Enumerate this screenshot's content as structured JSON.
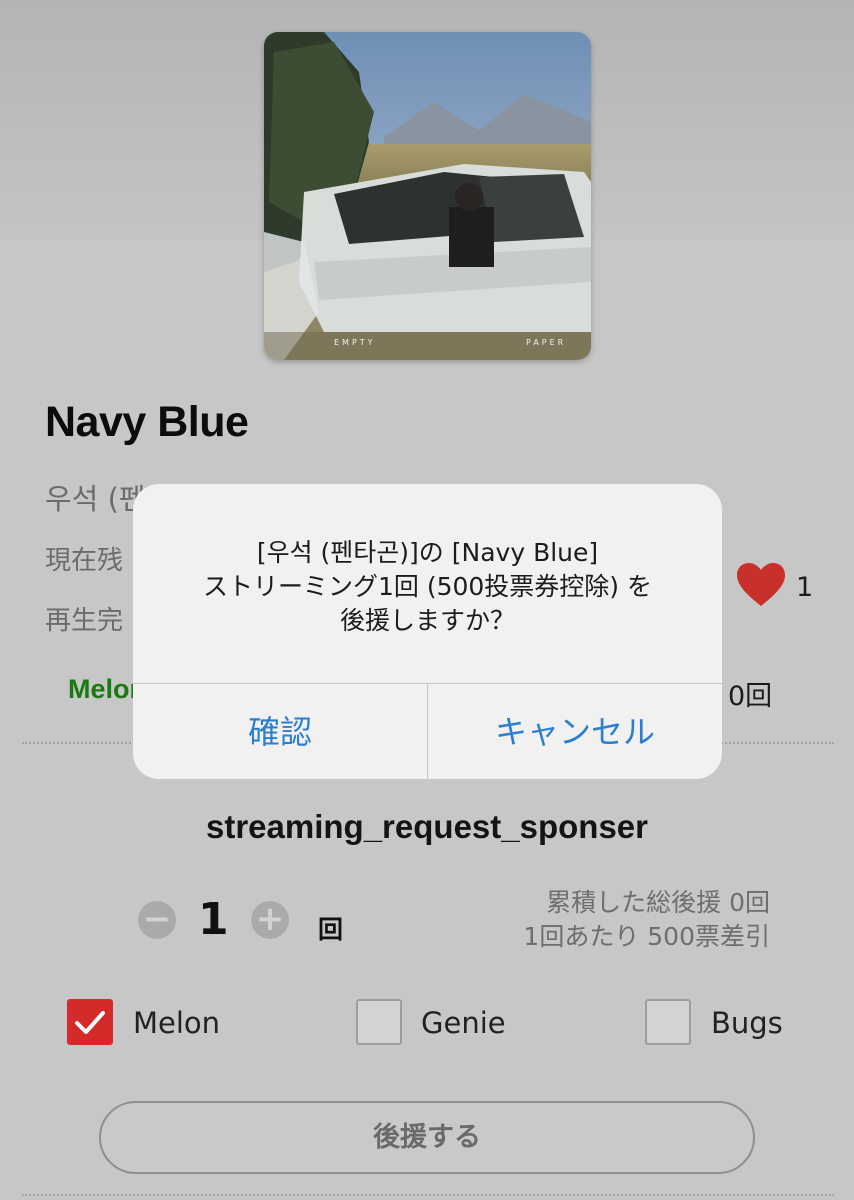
{
  "song": {
    "title": "Navy Blue",
    "artist": "우석 (펜타곤)",
    "remaining_label": "現在残",
    "playback_label": "再生完",
    "heart_count": "1",
    "platform_label": "Melon",
    "platform_count": "0回"
  },
  "cover": {
    "left_text": "EMPTY",
    "right_text": "PAPER"
  },
  "sponsor": {
    "heading": "streaming_request_sponser",
    "quantity": "1",
    "unit": "回",
    "total_support": "累積した総後援 0回",
    "per_play_cost": "1回あたり 500票差引",
    "minus": "−",
    "plus": "+"
  },
  "platforms": [
    {
      "label": "Melon",
      "checked": true
    },
    {
      "label": "Genie",
      "checked": false
    },
    {
      "label": "Bugs",
      "checked": false
    }
  ],
  "support_button_label": "後援する",
  "dialog": {
    "line1": "[우석 (펜타곤)]の [Navy Blue]",
    "line2": "ストリーミング1回 (500投票券控除) を",
    "line3": "後援しますか？",
    "confirm_label": "確認",
    "cancel_label": "キャンセル"
  },
  "colors": {
    "accent_blue": "#2b7fd1",
    "melon_green": "#1a7a12",
    "heart_red": "#c8302c",
    "check_red": "#d52a2a"
  }
}
